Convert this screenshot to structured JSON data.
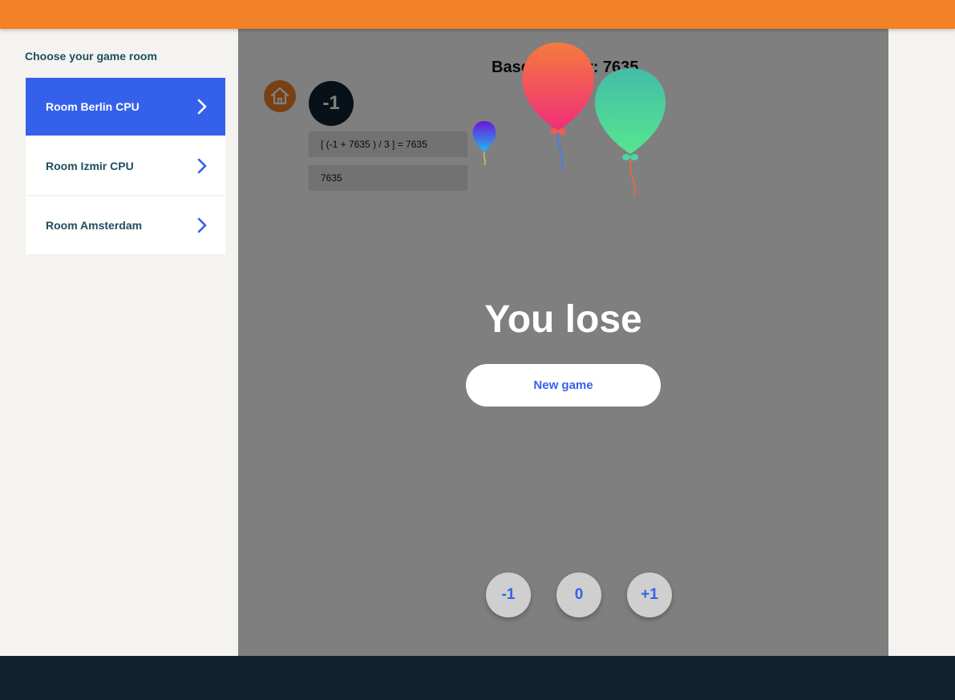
{
  "sidebar": {
    "title": "Choose your game room",
    "rooms": [
      {
        "label": "Room Berlin CPU",
        "active": true
      },
      {
        "label": "Room Izmir CPU",
        "active": false
      },
      {
        "label": "Room Amsterdam",
        "active": false
      }
    ]
  },
  "game": {
    "base_number_label": "Base number: 7635",
    "player_value": "-1",
    "calculation": "[ (-1 + 7635 ) / 3 ] = 7635",
    "current_number": "7635",
    "result": "You lose",
    "new_game_label": "New game",
    "moves": [
      "-1",
      "0",
      "+1"
    ]
  },
  "icons": {
    "home": "home-icon",
    "chevron": "chevron-right-icon"
  },
  "colors": {
    "header": "#f28127",
    "footer": "#10222e",
    "accent": "#3561ea",
    "avatar": "#10222e"
  }
}
